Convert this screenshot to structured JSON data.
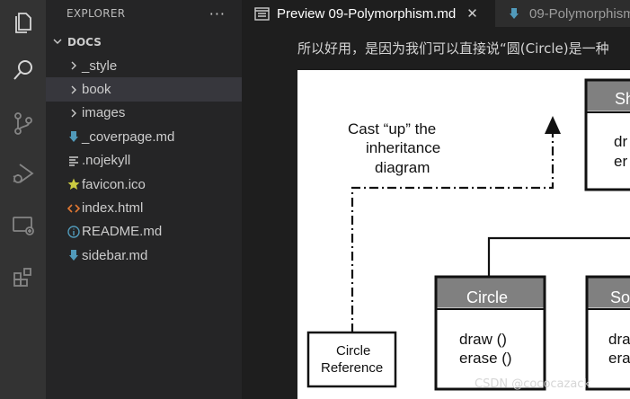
{
  "sidebar": {
    "title": "EXPLORER",
    "more": "···",
    "section": "DOCS",
    "items": [
      {
        "label": "_style",
        "kind": "folder"
      },
      {
        "label": "book",
        "kind": "folder",
        "selected": true
      },
      {
        "label": "images",
        "kind": "folder"
      },
      {
        "label": "_coverpage.md",
        "kind": "markdown"
      },
      {
        "label": ".nojekyll",
        "kind": "text"
      },
      {
        "label": "favicon.ico",
        "kind": "favicon"
      },
      {
        "label": "index.html",
        "kind": "html"
      },
      {
        "label": "README.md",
        "kind": "info"
      },
      {
        "label": "sidebar.md",
        "kind": "markdown"
      }
    ]
  },
  "tabs": [
    {
      "label": "Preview 09-Polymorphism.md",
      "close": "✕",
      "icon": "preview-icon"
    },
    {
      "label": "09-Polymorphism",
      "icon": "markdown-icon"
    }
  ],
  "content": {
    "text": "所以好用，是因为我们可以直接说“圆(Circle)是一种",
    "diagram": {
      "cast_note": [
        "Cast “up” the",
        "inheritance",
        "diagram"
      ],
      "shape_header": "Sh",
      "shape_methods": [
        "dr",
        "er"
      ],
      "circle_header": "Circle",
      "circle_methods": [
        "draw ()",
        "erase ()"
      ],
      "square_header": "So",
      "square_methods": [
        "dra",
        "era"
      ],
      "ref_label": [
        "Circle",
        "Reference"
      ]
    }
  },
  "watermark": "CSDN @cococazack",
  "colors": {
    "activity_bar": "#333333",
    "sidebar": "#252526",
    "editor": "#1e1e1e",
    "selected_row": "#37373d",
    "uml_header": "#808080",
    "markdown_icon": "#519aba",
    "html_icon": "#e37933",
    "favicon_star": "#cbcb41"
  }
}
